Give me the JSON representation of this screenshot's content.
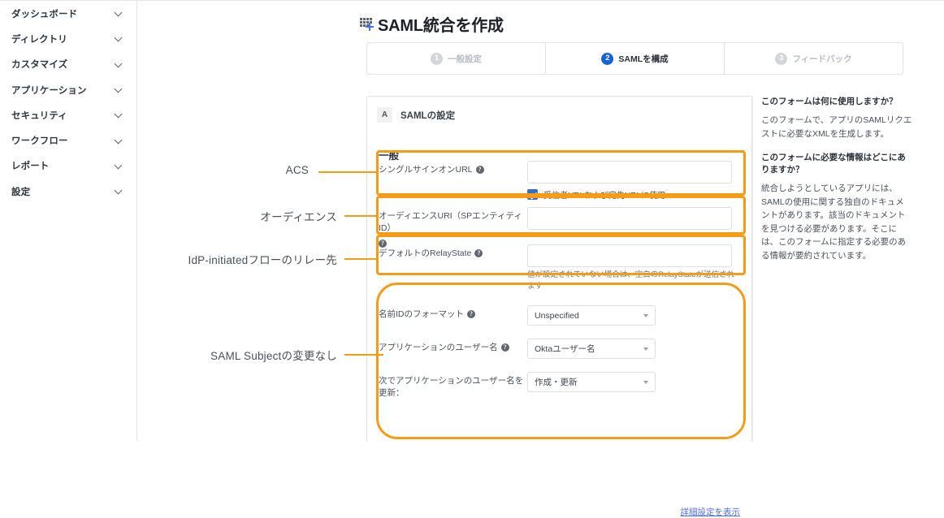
{
  "sidebar": {
    "items": [
      {
        "label": "ダッシュボード",
        "icon": "chevron-down-icon"
      },
      {
        "label": "ディレクトリ",
        "icon": "chevron-down-icon"
      },
      {
        "label": "カスタマイズ",
        "icon": "chevron-down-icon"
      },
      {
        "label": "アプリケーション",
        "icon": "chevron-down-icon"
      },
      {
        "label": "セキュリティ",
        "icon": "chevron-down-icon"
      },
      {
        "label": "ワークフロー",
        "icon": "chevron-down-icon"
      },
      {
        "label": "レポート",
        "icon": "chevron-down-icon"
      },
      {
        "label": "設定",
        "icon": "chevron-down-icon"
      }
    ]
  },
  "header": {
    "title": "SAML統合を作成",
    "icon": "app-add-icon"
  },
  "stepper": {
    "steps": [
      {
        "num": "1",
        "label": "一般設定",
        "active": false
      },
      {
        "num": "2",
        "label": "SAMLを構成",
        "active": true
      },
      {
        "num": "3",
        "label": "フィードバック",
        "active": false
      }
    ]
  },
  "card": {
    "chip": "A",
    "head_title": "SAMLの設定",
    "section_title": "一般",
    "fields": {
      "sso_url": {
        "label": "シングルサインオンURL",
        "value": "",
        "placeholder": "",
        "checkbox_label": "受信者URLおよび宛先URLに使用",
        "checked": true
      },
      "audience_uri": {
        "label": "オーディエンスURI（SPエンティティID）",
        "value": "",
        "placeholder": ""
      },
      "default_relay_state": {
        "label": "デフォルトのRelayState",
        "value": "",
        "placeholder": "",
        "hint": "値が設定されていない場合は、空白のRelayStateが送信されます"
      },
      "name_id_format": {
        "label": "名前IDのフォーマット",
        "value": "Unspecified"
      },
      "application_username": {
        "label": "アプリケーションのユーザー名",
        "value": "Oktaユーザー名"
      },
      "update_username_on": {
        "label": "次でアプリケーションのユーザー名を更新：",
        "value": "作成・更新"
      }
    },
    "advanced_link": "詳細設定を表示"
  },
  "help": {
    "blocks": [
      {
        "heading": "このフォームは何に使用しますか？",
        "body": "このフォームで、アプリのSAMLリクエストに必要なXMLを生成します。"
      },
      {
        "heading": "このフォームに必要な情報はどこにありますか？",
        "body": "統合しようとしているアプリには、SAMLの使用に関する独自のドキュメントがあります。該当のドキュメントを見つける必要があります。そこには、このフォームに指定する必要のある情報が要約されています。"
      }
    ]
  },
  "annotations": {
    "acs": "ACS",
    "audience": "オーディエンス",
    "relay": "IdP-initiatedフローのリレー先",
    "subject": "SAML Subjectの変更なし",
    "color": "#f59b14"
  }
}
